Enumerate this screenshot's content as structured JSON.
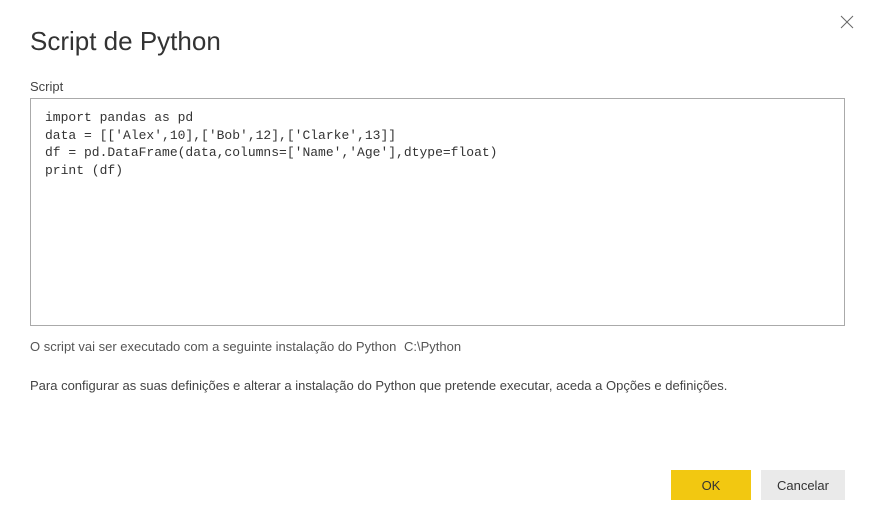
{
  "dialog": {
    "title": "Script de Python",
    "field_label": "Script",
    "script_value": "import pandas as pd\ndata = [['Alex',10],['Bob',12],['Clarke',13]]\ndf = pd.DataFrame(data,columns=['Name','Age'],dtype=float)\nprint (df)",
    "info_text": "O script vai ser executado com a seguinte instalação do Python",
    "info_path": "C:\\Python",
    "settings_text": "Para configurar as suas definições e alterar a instalação do Python que pretende executar, aceda a Opções e definições.",
    "ok_label": "OK",
    "cancel_label": "Cancelar"
  }
}
